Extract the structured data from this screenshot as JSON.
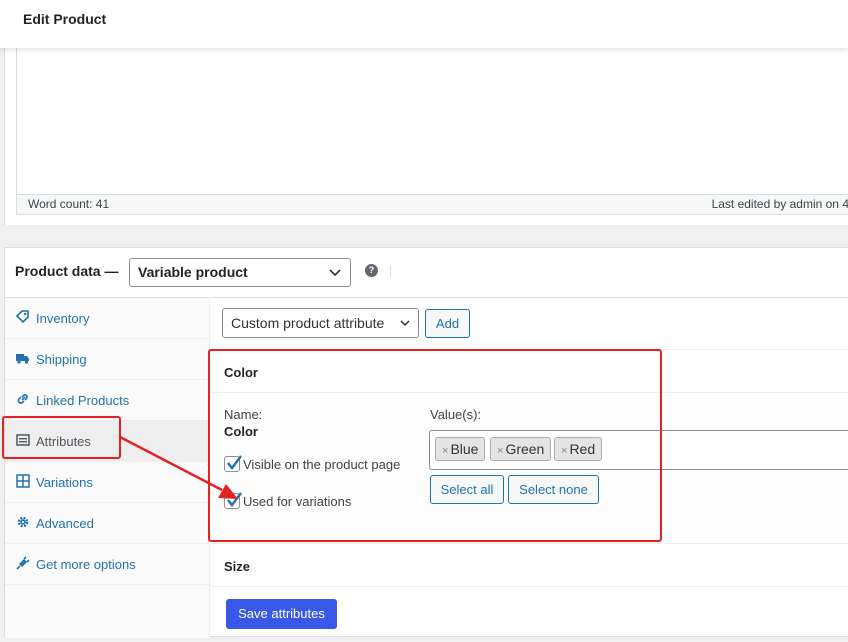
{
  "header": {
    "title": "Edit Product"
  },
  "editor": {
    "word_count": "Word count: 41",
    "last_edited": "Last edited by admin on 4"
  },
  "product_data": {
    "label": "Product data —",
    "type_selected": "Variable product",
    "help_icon": "question-circle-icon"
  },
  "tabs": [
    {
      "label": "Inventory",
      "icon": "tag-icon"
    },
    {
      "label": "Shipping",
      "icon": "truck-icon"
    },
    {
      "label": "Linked Products",
      "icon": "link-icon"
    },
    {
      "label": "Attributes",
      "icon": "list-icon",
      "active": true
    },
    {
      "label": "Variations",
      "icon": "grid-icon"
    },
    {
      "label": "Advanced",
      "icon": "gear-icon"
    },
    {
      "label": "Get more options",
      "icon": "plugin-icon"
    }
  ],
  "attributes_panel": {
    "select_value": "Custom product attribute",
    "add_button": "Add",
    "color": {
      "header": "Color",
      "name_label": "Name:",
      "name_value": "Color",
      "values_label": "Value(s):",
      "values": [
        "Blue",
        "Green",
        "Red"
      ],
      "visible_label": "Visible on the product page",
      "visible_checked": true,
      "variations_label": "Used for variations",
      "variations_checked": true,
      "select_all": "Select all",
      "select_none": "Select none"
    },
    "size": {
      "header": "Size"
    },
    "save_button": "Save attributes"
  },
  "colors": {
    "accent": "#2271b1",
    "primary_button": "#3858e9",
    "annotation": "#e32221"
  }
}
